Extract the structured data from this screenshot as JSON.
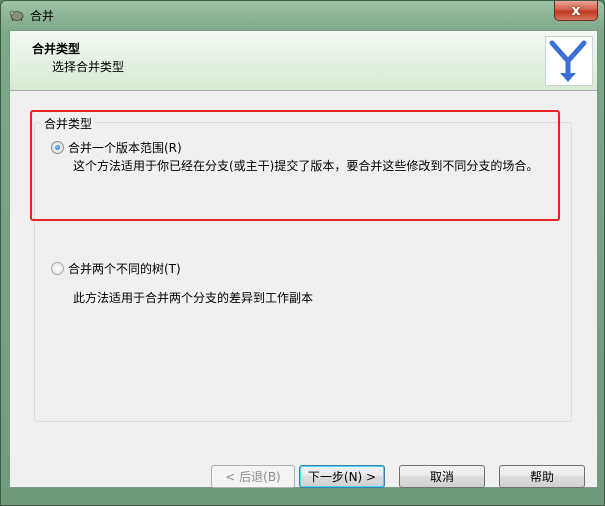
{
  "window": {
    "title": "合并",
    "close_glyph": "x"
  },
  "header": {
    "title": "合并类型",
    "subtitle": "选择合并类型"
  },
  "group": {
    "legend": "合并类型"
  },
  "options": [
    {
      "label": "合并一个版本范围(R)",
      "description": "这个方法适用于你已经在分支(或主干)提交了版本，要合并这些修改到不同分支的场合。",
      "checked": true
    },
    {
      "label": "合并两个不同的树(T)",
      "description": "此方法适用于合并两个分支的差异到工作副本",
      "checked": false
    }
  ],
  "buttons": {
    "back": "< 后退(B)",
    "next": "下一步(N) >",
    "cancel": "取消",
    "help": "帮助"
  },
  "colors": {
    "highlight": "#e8242a",
    "logo_blue": "#3b6fd6"
  }
}
